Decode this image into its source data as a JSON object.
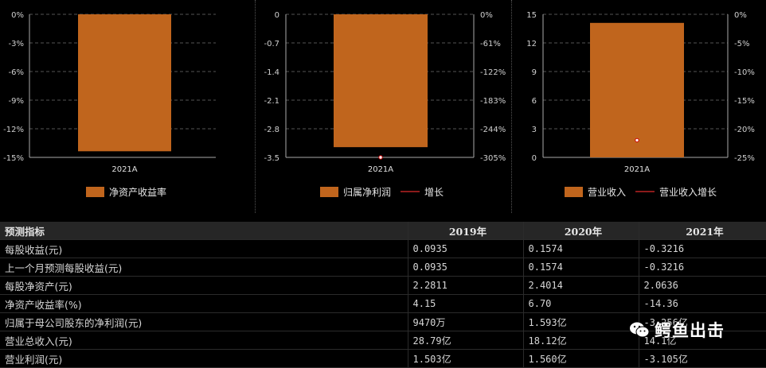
{
  "colors": {
    "bar": "#c0651d",
    "growth_line": "#8b1a1a",
    "grid": "#555555",
    "point": "#ffffff"
  },
  "chart_data": [
    {
      "type": "bar",
      "categories": [
        "2021A"
      ],
      "series": [
        {
          "name": "净资产收益率",
          "values": [
            -14.36
          ]
        }
      ],
      "y_ticks": [
        "0%",
        "-3%",
        "-6%",
        "-9%",
        "-12%",
        "-15%"
      ],
      "ylim": [
        -15,
        0
      ]
    },
    {
      "type": "bar",
      "categories": [
        "2021A"
      ],
      "series": [
        {
          "name": "归属净利润",
          "values": [
            -3.25
          ]
        },
        {
          "name": "增长",
          "values": [
            -305
          ]
        }
      ],
      "y_ticks_left": [
        "0",
        "-0.7",
        "-1.4",
        "-2.1",
        "-2.8",
        "-3.5"
      ],
      "y_ticks_right": [
        "0%",
        "-61%",
        "-122%",
        "-183%",
        "-244%",
        "-305%"
      ],
      "ylim_left": [
        -3.5,
        0
      ],
      "ylim_right": [
        -305,
        0
      ]
    },
    {
      "type": "bar",
      "categories": [
        "2021A"
      ],
      "series": [
        {
          "name": "营业收入",
          "values": [
            14.1
          ]
        },
        {
          "name": "营业收入增长",
          "values": [
            -22
          ]
        }
      ],
      "y_ticks_left": [
        "15",
        "12",
        "9",
        "6",
        "3",
        "0"
      ],
      "y_ticks_right": [
        "0%",
        "-5%",
        "-10%",
        "-15%",
        "-20%",
        "-25%"
      ],
      "ylim_left": [
        0,
        15
      ],
      "ylim_right": [
        -25,
        0
      ]
    }
  ],
  "table": {
    "headers": [
      "预测指标",
      "2019年",
      "2020年",
      "2021年"
    ],
    "rows": [
      [
        "每股收益(元)",
        "0.0935",
        "0.1574",
        "-0.3216"
      ],
      [
        "上一个月预测每股收益(元)",
        "0.0935",
        "0.1574",
        "-0.3216"
      ],
      [
        "每股净资产(元)",
        "2.2811",
        "2.4014",
        "2.0636"
      ],
      [
        "净资产收益率(%)",
        "4.15",
        "6.70",
        "-14.36"
      ],
      [
        "归属于母公司股东的净利润(元)",
        "9470万",
        "1.593亿",
        "-3.256亿"
      ],
      [
        "营业总收入(元)",
        "28.79亿",
        "18.12亿",
        "14.1亿"
      ],
      [
        "营业利润(元)",
        "1.503亿",
        "1.560亿",
        "-3.105亿"
      ]
    ]
  },
  "watermark": {
    "text": "鳄鱼出击",
    "icon": "wechat-icon"
  }
}
